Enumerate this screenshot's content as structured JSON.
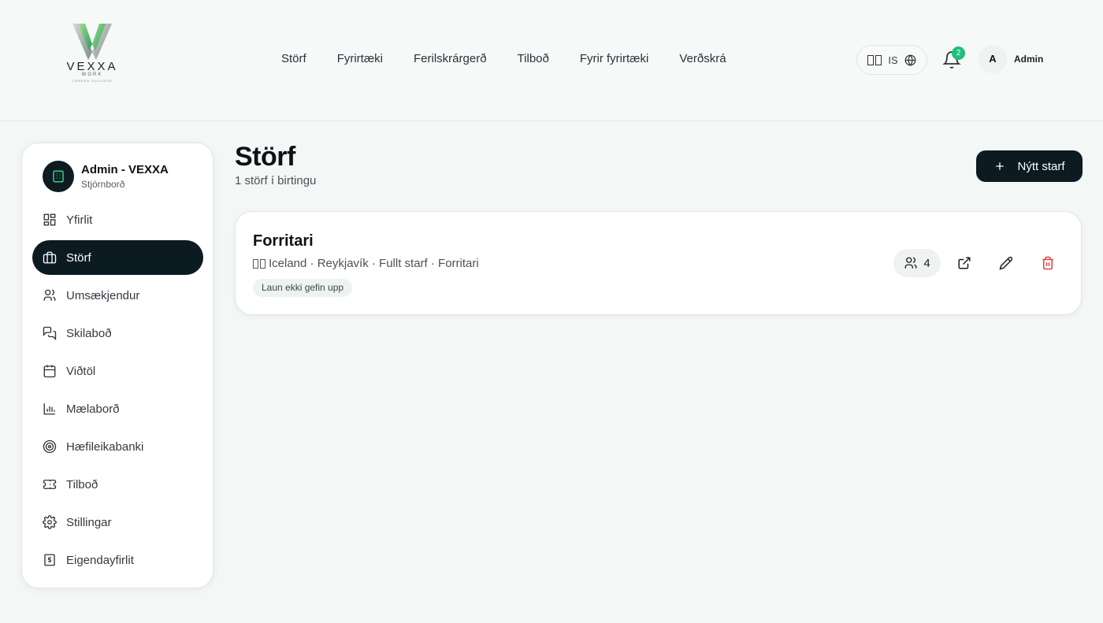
{
  "brand": {
    "logo_text": "VEXXA",
    "logo_sub": "WORK",
    "logo_tagline": "CAREER SUCCESS"
  },
  "nav": {
    "items": [
      "Störf",
      "Fyrirtæki",
      "Ferilskrárgerð",
      "Tilboð",
      "Fyrir fyrirtæki",
      "Verðskrá"
    ]
  },
  "header": {
    "language": "IS",
    "notifications_count": "2",
    "avatar_initial": "A",
    "user_name": "Admin"
  },
  "sidebar": {
    "org_name": "Admin - VEXXA",
    "org_sub": "Stjórnborð",
    "items": [
      {
        "label": "Yfirlit",
        "icon": "grid-icon"
      },
      {
        "label": "Störf",
        "icon": "briefcase-icon",
        "active": true
      },
      {
        "label": "Umsækjendur",
        "icon": "users-icon"
      },
      {
        "label": "Skilaboð",
        "icon": "messages-icon"
      },
      {
        "label": "Viðtöl",
        "icon": "calendar-icon"
      },
      {
        "label": "Mælaborð",
        "icon": "bar-chart-icon"
      },
      {
        "label": "Hæfileikabanki",
        "icon": "target-icon"
      },
      {
        "label": "Tilboð",
        "icon": "ticket-icon"
      },
      {
        "label": "Stillingar",
        "icon": "gear-icon"
      },
      {
        "label": "Eigendayfirlit",
        "icon": "dollar-doc-icon"
      }
    ]
  },
  "main": {
    "title": "Störf",
    "subtitle": "1 störf í birtingu",
    "new_button_label": "Nýtt starf"
  },
  "jobs": [
    {
      "title": "Forritari",
      "meta": "Iceland · Reykjavík · Fullt starf · Forritari",
      "salary_tag": "Laun ekki gefin upp",
      "applicants": "4"
    }
  ],
  "colors": {
    "accent": "#1fbf7a",
    "dark": "#0c1a22",
    "danger": "#d64545"
  }
}
